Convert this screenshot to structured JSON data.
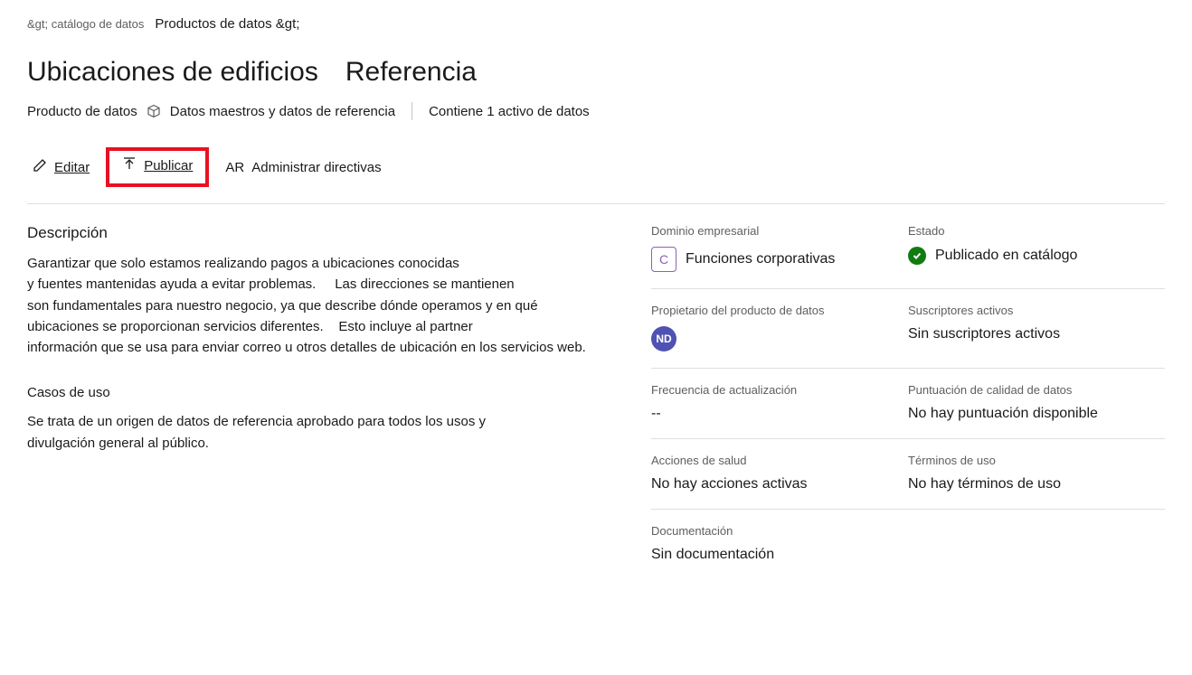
{
  "breadcrumb": {
    "crumb1": "&gt; catálogo de datos",
    "crumb2": "Productos de datos &gt;"
  },
  "title": "Ubicaciones de edificios",
  "reference_tag": "Referencia",
  "subtitle": {
    "product_label": "Producto de datos",
    "category": "Datos maestros y datos de referencia",
    "asset_count": "Contiene 1 activo de datos"
  },
  "actions": {
    "edit": "Editar",
    "publish": "Publicar",
    "ar_badge": "AR",
    "manage_policies": "Administrar directivas"
  },
  "description": {
    "heading": "Descripción",
    "line1": "Garantizar que solo estamos realizando pagos a ubicaciones conocidas",
    "line2a": "y fuentes mantenidas ayuda a evitar problemas.",
    "line2b": "Las direcciones se mantienen",
    "line3": "son fundamentales para nuestro negocio, ya que describe dónde operamos y en qué",
    "line4a": "ubicaciones se proporcionan servicios diferentes.",
    "line4b": "Esto incluye al partner",
    "line5": "información que se usa para enviar correo u otros detalles de ubicación en los servicios web."
  },
  "use_cases": {
    "heading": "Casos de uso",
    "line1": "Se trata de un origen de datos de referencia aprobado para todos los usos y",
    "line2": "divulgación general al público."
  },
  "props": {
    "business_domain": {
      "label": "Dominio empresarial",
      "badge": "C",
      "value": "Funciones corporativas"
    },
    "status": {
      "label": "Estado",
      "value": "Publicado en catálogo"
    },
    "owner": {
      "label": "Propietario del producto de datos",
      "avatar": "ND"
    },
    "subscribers": {
      "label": "Suscriptores activos",
      "value": "Sin suscriptores activos"
    },
    "update_freq": {
      "label": "Frecuencia de actualización",
      "value": "--"
    },
    "quality": {
      "label": "Puntuación de calidad de datos",
      "value": "No hay puntuación disponible"
    },
    "health": {
      "label": "Acciones de salud",
      "value": "No hay acciones activas"
    },
    "terms": {
      "label": "Términos de uso",
      "value": "No hay términos de uso"
    },
    "docs": {
      "label": "Documentación",
      "value": "Sin documentación"
    }
  }
}
